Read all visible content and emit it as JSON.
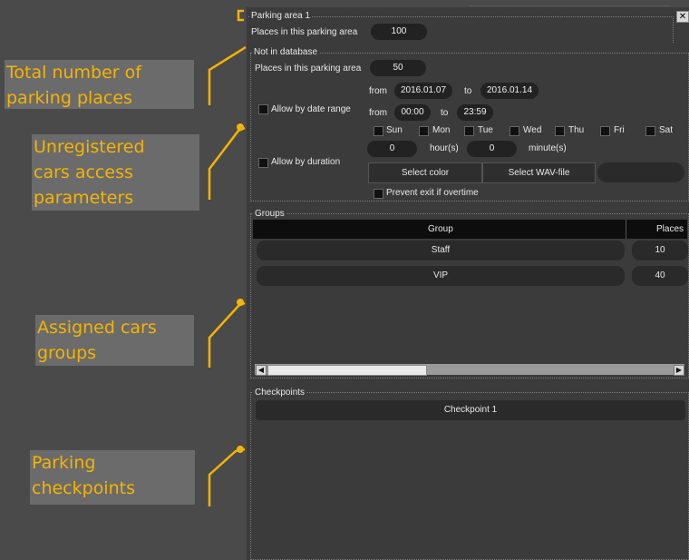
{
  "window": {
    "close_icon": "close-icon"
  },
  "parking_area": {
    "title": "Parking area 1",
    "places_label": "Places in this parking area",
    "places_value": "100"
  },
  "not_in_db": {
    "title": "Not in database",
    "places_label": "Places in this parking area",
    "places_value": "50",
    "allow_date_label": "Allow by date range",
    "allow_duration_label": "Allow by duration",
    "from1": "from",
    "date_from": "2016.01.07",
    "to1": "to",
    "date_to": "2016.01.14",
    "from2": "from",
    "time_from": "00:00",
    "to2": "to",
    "time_to": "23:59",
    "days": [
      "Sun",
      "Mon",
      "Tue",
      "Wed",
      "Thu",
      "Fri",
      "Sat"
    ],
    "hours_value": "0",
    "hours_label": "hour(s)",
    "minutes_value": "0",
    "minutes_label": "minute(s)",
    "select_color": "Select color",
    "select_wav": "Select WAV-file",
    "prevent_exit": "Prevent exit if overtime"
  },
  "groups": {
    "title": "Groups",
    "columns": [
      "Group",
      "Places"
    ],
    "rows": [
      {
        "name": "Staff",
        "places": "10"
      },
      {
        "name": "VIP",
        "places": "40"
      }
    ]
  },
  "checkpoints": {
    "title": "Checkpoints",
    "items": [
      "Checkpoint 1"
    ]
  },
  "annotations": {
    "total": "Total number of\nparking places",
    "unregistered": "Unregistered\ncars access\nparameters",
    "assigned": "Assigned cars\ngroups",
    "checkpoints": "Parking\ncheckpoints"
  },
  "colors": {
    "accent": "#f5b400",
    "annotation_bg": "#6b6b6b",
    "panel_bg": "#3b3b3b"
  }
}
